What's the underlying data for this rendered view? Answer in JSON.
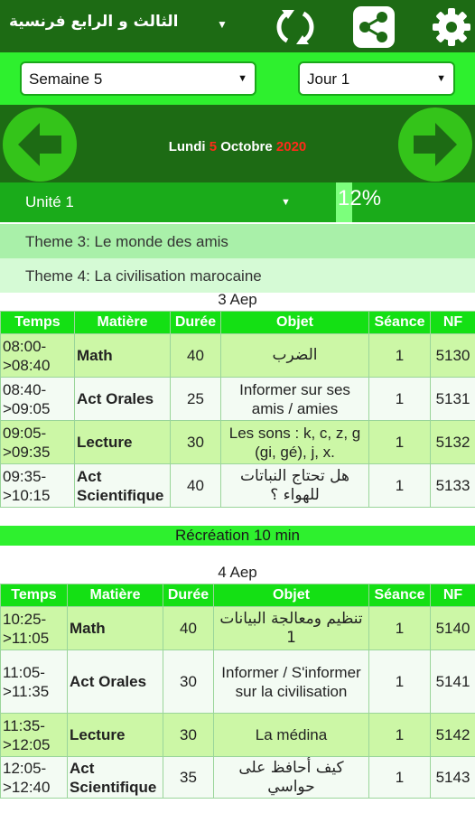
{
  "header": {
    "title": "الثالث و الرابع فرنسية",
    "icons": [
      "refresh-icon",
      "share-icon",
      "gear-icon"
    ]
  },
  "selectors": {
    "week": "Semaine 5",
    "day": "Jour 1"
  },
  "date": {
    "weekday": "Lundi",
    "day": "5",
    "month": "Octobre",
    "year": "2020"
  },
  "unit": {
    "label": "Unité 1",
    "progress_text": "12%",
    "progress_value": 0.12
  },
  "themes": [
    "Theme 3: Le monde des amis",
    "Theme 4: La civilisation marocaine"
  ],
  "columns": [
    "Temps",
    "Matière",
    "Durée",
    "Objet",
    "Séance",
    "NF"
  ],
  "class3": {
    "title": "3 Aep",
    "rows": [
      {
        "start": "08:00-",
        "end": ">08:40",
        "matiere": "Math",
        "duree": "40",
        "objet": "الضرب",
        "seance": "1",
        "nf": "5130"
      },
      {
        "start": "08:40-",
        "end": ">09:05",
        "matiere": "Act Orales",
        "duree": "25",
        "objet": "Informer sur ses amis / amies",
        "seance": "1",
        "nf": "5131"
      },
      {
        "start": "09:05-",
        "end": ">09:35",
        "matiere": "Lecture",
        "duree": "30",
        "objet": "Les sons : k, c, z, g (gi, gé), j, x.",
        "seance": "1",
        "nf": "5132"
      },
      {
        "start": "09:35-",
        "end": ">10:15",
        "matiere": "Act Scientifique",
        "duree": "40",
        "objet": "هل تحتاج النباتات للهواء ؟",
        "seance": "1",
        "nf": "5133"
      }
    ]
  },
  "recreation": "Récréation 10 min",
  "class4": {
    "title": "4 Aep",
    "rows": [
      {
        "start": "10:25-",
        "end": ">11:05",
        "matiere": "Math",
        "duree": "40",
        "objet": "تنظيم ومعالجة البيانات 1",
        "seance": "1",
        "nf": "5140"
      },
      {
        "start": "11:05-",
        "end": ">11:35",
        "matiere": "Act Orales",
        "duree": "30",
        "objet": "Informer / S'informer sur la civilisation",
        "seance": "1",
        "nf": "5141"
      },
      {
        "start": "11:35-",
        "end": ">12:05",
        "matiere": "Lecture",
        "duree": "30",
        "objet": "La médina",
        "seance": "1",
        "nf": "5142"
      },
      {
        "start": "12:05-",
        "end": ">12:40",
        "matiere": "Act Scientifique",
        "duree": "35",
        "objet": "كيف أحافظ على حواسي",
        "seance": "1",
        "nf": "5143"
      }
    ]
  }
}
